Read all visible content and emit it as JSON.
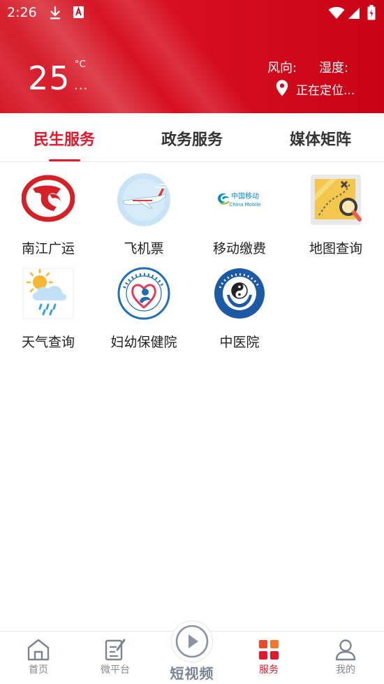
{
  "status_bar": {
    "time": "2:26"
  },
  "weather": {
    "temperature": "25",
    "unit": "°C",
    "description": "...",
    "wind_label": "风向:",
    "humidity_label": "湿度:",
    "location": "正在定位..."
  },
  "tabs": [
    {
      "label": "民生服务",
      "active": true
    },
    {
      "label": "政务服务",
      "active": false
    },
    {
      "label": "媒体矩阵",
      "active": false
    }
  ],
  "services": [
    {
      "label": "南江广运",
      "icon": "nanjiang-guangyun-logo"
    },
    {
      "label": "飞机票",
      "icon": "airplane-icon"
    },
    {
      "label": "移动缴费",
      "icon": "china-mobile-logo",
      "logo_text": "中国移动",
      "logo_subtext": "China Mobile"
    },
    {
      "label": "地图查询",
      "icon": "map-search-icon"
    },
    {
      "label": "天气查询",
      "icon": "weather-icon"
    },
    {
      "label": "妇幼保健院",
      "icon": "maternal-hospital-logo"
    },
    {
      "label": "中医院",
      "icon": "tcm-hospital-logo"
    }
  ],
  "bottom_nav": {
    "home": "首页",
    "weibo": "微平台",
    "video": "短视频",
    "service": "服务",
    "me": "我的"
  },
  "colors": {
    "brand_red": "#e0192c",
    "header_red": "#d51a27",
    "nav_inactive": "#888888"
  }
}
